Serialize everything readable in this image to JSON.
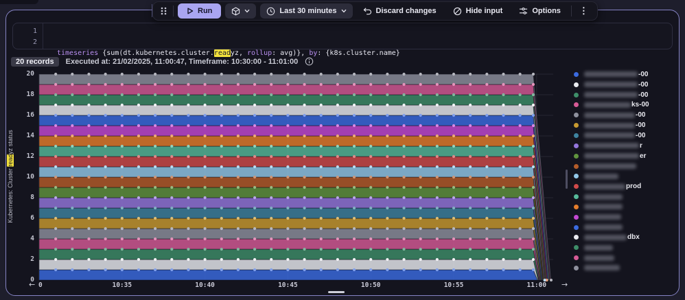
{
  "toolbar": {
    "run_label": "Run",
    "time_range_label": "Last 30 minutes",
    "discard_label": "Discard changes",
    "hide_input_label": "Hide input",
    "options_label": "Options",
    "kebab_glyph": "⋮",
    "accent_color": "#a9a5f1"
  },
  "editor": {
    "line_numbers": [
      "1",
      "2"
    ],
    "tokens": [
      {
        "t": "timeseries ",
        "c": "kw"
      },
      {
        "t": "{sum(dt.kubernetes.cluster.",
        "c": "pl"
      },
      {
        "t": "read",
        "c": "hl"
      },
      {
        "t": "yz",
        "c": "pl"
      },
      {
        "t": ", ",
        "c": "pl"
      },
      {
        "t": "rollup",
        "c": "kw"
      },
      {
        "t": ": ",
        "c": "pl"
      },
      {
        "t": "avg",
        "c": "pl"
      },
      {
        "t": ")}, ",
        "c": "pl"
      },
      {
        "t": "by",
        "c": "kw"
      },
      {
        "t": ": ",
        "c": "pl"
      },
      {
        "t": "{k8s.cluster.name}",
        "c": "pl"
      }
    ]
  },
  "status": {
    "records_badge": "20 records",
    "executed_text": "Executed at: 21/02/2025, 11:00:47, Timeframe: 10:30:00 - 11:01:00"
  },
  "nav": {
    "left_arrow": "←",
    "right_arrow": "→"
  },
  "chart_data": {
    "type": "area",
    "stacked": true,
    "title": "",
    "ylabel": {
      "pre": "Kubernetes: Cluster ",
      "hl": "read",
      "post": "yz status"
    },
    "ylim": [
      0,
      20
    ],
    "y_tick_step": 2,
    "x_ticks": [
      "10:35",
      "10:40",
      "10:45",
      "10:50",
      "10:55",
      "11:00"
    ],
    "x_clipped_tick": "0",
    "timeframe_start": "10:30:00",
    "timeframe_end": "11:01:00",
    "grid": true,
    "legend_position": "right",
    "series_value_pattern": "each of the 20 series has constant value 1 (readyz) from 10:30 until ~10:59, then drops to 0 by ~11:00; stack total = 20",
    "series": [
      {
        "label_redacted": true,
        "label_visible_suffix": "-00",
        "color": "#3b6be0",
        "value": 1,
        "legend_blur_width": 78
      },
      {
        "label_redacted": true,
        "label_visible_suffix": "-00",
        "color": "#e9ebf0",
        "value": 1,
        "legend_blur_width": 78
      },
      {
        "label_redacted": true,
        "label_visible_suffix": "-00",
        "color": "#3e8e69",
        "value": 1,
        "legend_blur_width": 78
      },
      {
        "label_redacted": true,
        "label_visible_suffix": "ks-00",
        "color": "#d65a96",
        "value": 1,
        "legend_blur_width": 68
      },
      {
        "label_redacted": true,
        "label_visible_suffix": "-00",
        "color": "#8e909d",
        "value": 1,
        "legend_blur_width": 74
      },
      {
        "label_redacted": true,
        "label_visible_suffix": "-00",
        "color": "#c89a30",
        "value": 1,
        "legend_blur_width": 74
      },
      {
        "label_redacted": true,
        "label_visible_suffix": "-00",
        "color": "#3e83a0",
        "value": 1,
        "legend_blur_width": 74
      },
      {
        "label_redacted": true,
        "label_visible_suffix": "r",
        "color": "#9476dc",
        "value": 1,
        "legend_blur_width": 80
      },
      {
        "label_redacted": true,
        "label_visible_suffix": "er",
        "color": "#60943e",
        "value": 1,
        "legend_blur_width": 80
      },
      {
        "label_redacted": true,
        "label_visible_suffix": "",
        "color": "#b45c2a",
        "value": 1,
        "legend_blur_width": 76
      },
      {
        "label_redacted": true,
        "label_visible_suffix": "",
        "color": "#92c8e9",
        "value": 1,
        "legend_blur_width": 50
      },
      {
        "label_redacted": true,
        "label_visible_suffix": "prod",
        "color": "#d04a4a",
        "value": 1,
        "legend_blur_width": 60
      },
      {
        "label_redacted": true,
        "label_visible_suffix": "",
        "color": "#56ba9a",
        "value": 1,
        "legend_blur_width": 56
      },
      {
        "label_redacted": true,
        "label_visible_suffix": "",
        "color": "#e47d2c",
        "value": 1,
        "legend_blur_width": 56
      },
      {
        "label_redacted": true,
        "label_visible_suffix": "",
        "color": "#c349d2",
        "value": 1,
        "legend_blur_width": 54
      },
      {
        "label_redacted": true,
        "label_visible_suffix": "",
        "color": "#3b6be0",
        "value": 1,
        "legend_blur_width": 56
      },
      {
        "label_redacted": true,
        "label_visible_suffix": "dbx",
        "color": "#e9ebf0",
        "value": 1,
        "legend_blur_width": 62
      },
      {
        "label_redacted": true,
        "label_visible_suffix": "",
        "color": "#3e8e69",
        "value": 1,
        "legend_blur_width": 42
      },
      {
        "label_redacted": true,
        "label_visible_suffix": "",
        "color": "#d65a96",
        "value": 1,
        "legend_blur_width": 44
      },
      {
        "label_redacted": true,
        "label_visible_suffix": "",
        "color": "#8e909d",
        "value": 1,
        "legend_blur_width": 52
      }
    ]
  }
}
